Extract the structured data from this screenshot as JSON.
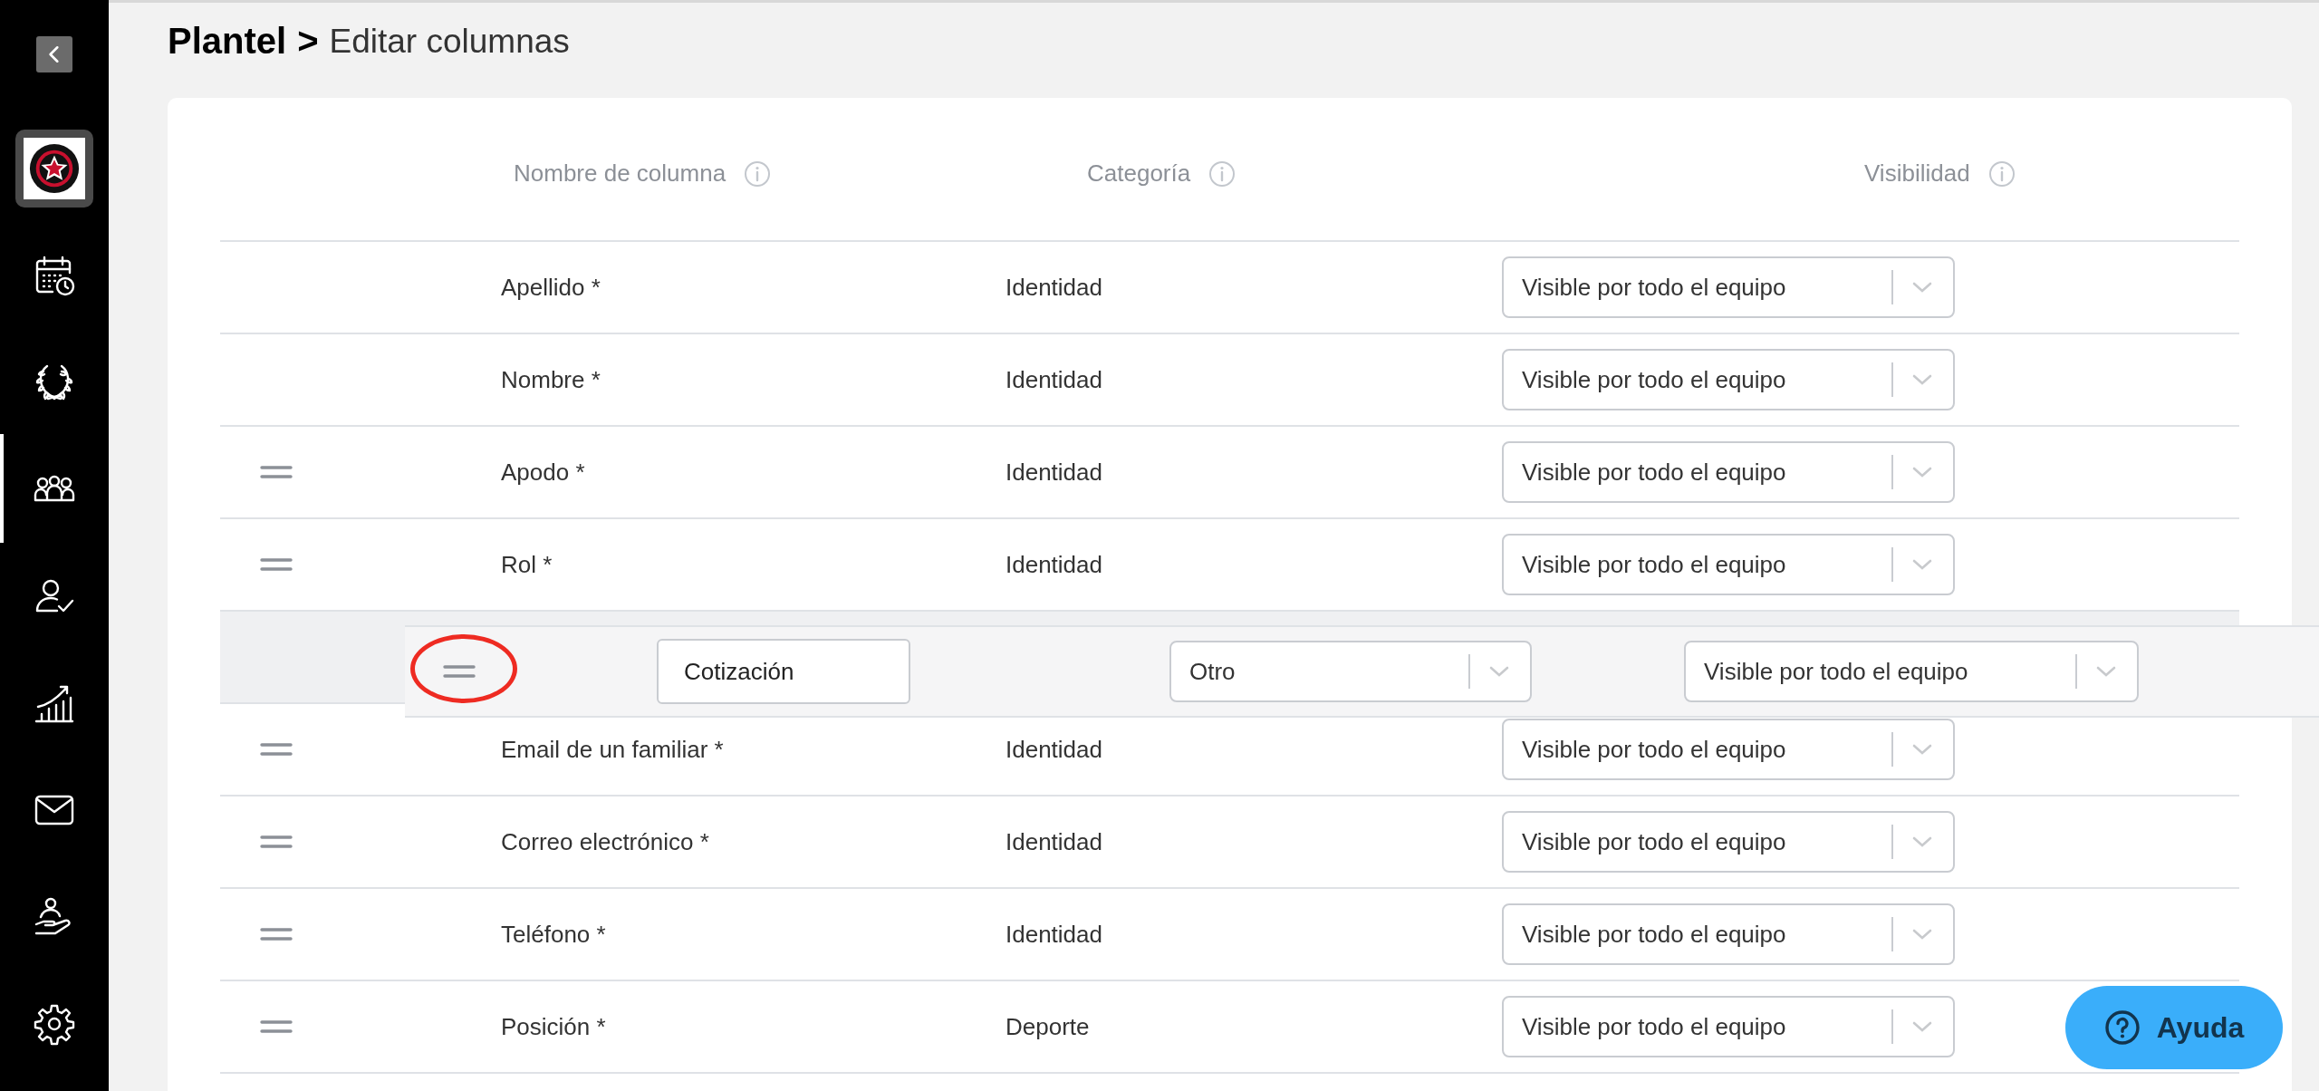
{
  "sidebar": {
    "items": [
      {
        "kind": "back",
        "selected": false
      },
      {
        "kind": "club",
        "selected": false
      },
      {
        "kind": "calendar",
        "selected": false
      },
      {
        "kind": "laurel",
        "selected": false
      },
      {
        "kind": "team",
        "selected": true
      },
      {
        "kind": "user-check",
        "selected": false
      },
      {
        "kind": "stats",
        "selected": false
      },
      {
        "kind": "mail",
        "selected": false
      },
      {
        "kind": "hand",
        "selected": false
      },
      {
        "kind": "settings",
        "selected": false
      }
    ]
  },
  "breadcrumb": {
    "parent": "Plantel",
    "separator": ">",
    "current": "Editar columnas"
  },
  "table": {
    "columns": [
      {
        "label": "Nombre de columna",
        "info": true
      },
      {
        "label": "Categoría",
        "info": true
      },
      {
        "label": "Visibilidad",
        "info": true
      }
    ],
    "rows": [
      {
        "kind": "fixed",
        "name": "Apellido *",
        "category": "Identidad",
        "visibility": "Visible por todo el equipo"
      },
      {
        "kind": "fixed",
        "name": "Nombre *",
        "category": "Identidad",
        "visibility": "Visible por todo el equipo"
      },
      {
        "kind": "movable",
        "name": "Apodo *",
        "category": "Identidad",
        "visibility": "Visible por todo el equipo"
      },
      {
        "kind": "movable",
        "name": "Rol *",
        "category": "Identidad",
        "visibility": "Visible por todo el equipo"
      },
      {
        "kind": "drop-gap"
      },
      {
        "kind": "movable",
        "name": "Email de un familiar *",
        "category": "Identidad",
        "visibility": "Visible por todo el equipo"
      },
      {
        "kind": "movable",
        "name": "Correo electrónico *",
        "category": "Identidad",
        "visibility": "Visible por todo el equipo"
      },
      {
        "kind": "movable",
        "name": "Teléfono *",
        "category": "Identidad",
        "visibility": "Visible por todo el equipo"
      },
      {
        "kind": "movable",
        "name": "Posición *",
        "category": "Deporte",
        "visibility": "Visible por todo el equipo"
      }
    ],
    "dragged_row": {
      "name": "Cotización",
      "category": "Otro",
      "visibility": "Visible por todo el equipo",
      "circled": true
    }
  },
  "help_button": {
    "label": "Ayuda"
  }
}
